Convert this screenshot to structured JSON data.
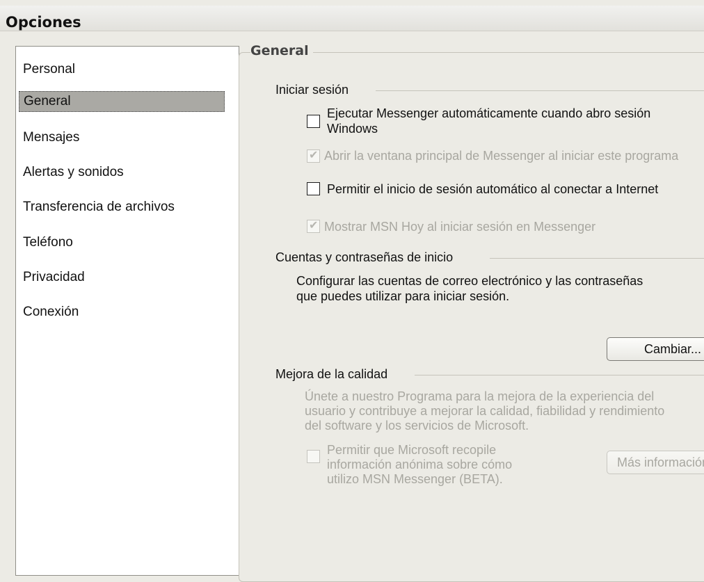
{
  "window": {
    "title": "Opciones"
  },
  "nav": {
    "items": [
      {
        "label": "Personal",
        "selected": false
      },
      {
        "label": "General",
        "selected": true
      },
      {
        "label": "Mensajes",
        "selected": false
      },
      {
        "label": "Alertas y sonidos",
        "selected": false
      },
      {
        "label": "Transferencia de archivos",
        "selected": false
      },
      {
        "label": "Teléfono",
        "selected": false
      },
      {
        "label": "Privacidad",
        "selected": false
      },
      {
        "label": "Conexión",
        "selected": false
      }
    ]
  },
  "general": {
    "title": "General",
    "login": {
      "title": "Iniciar sesión",
      "run_auto": {
        "line1": "Ejecutar Messenger automáticamente cuando abro sesión",
        "line2": "Windows",
        "checked": false
      },
      "open_main": {
        "label": "Abrir la ventana principal de Messenger al iniciar este programa",
        "checked": true,
        "enabled": false
      },
      "auto_login": {
        "label": "Permitir el inicio de sesión automático al conectar a Internet",
        "checked": false
      },
      "show_msn_today": {
        "label": "Mostrar MSN Hoy al iniciar sesión en Messenger",
        "checked": true,
        "enabled": false
      }
    },
    "accounts": {
      "title": "Cuentas y contraseñas de inicio",
      "desc_line1": "Configurar las cuentas de correo electrónico y las contraseñas",
      "desc_line2": "que puedes utilizar para iniciar sesión.",
      "change_button": "Cambiar..."
    },
    "quality": {
      "title": "Mejora de la calidad",
      "desc_line1": "Únete a nuestro Programa para la mejora de la experiencia del",
      "desc_line2": "usuario y contribuye a mejorar la calidad, fiabilidad y rendimiento",
      "desc_line3": "del software y los servicios de Microsoft.",
      "allow": {
        "line1": "Permitir que Microsoft recopile",
        "line2": "información anónima sobre cómo",
        "line3": "utilizo MSN Messenger (BETA).",
        "checked": false,
        "enabled": false
      },
      "more_info_button": "Más información"
    }
  }
}
